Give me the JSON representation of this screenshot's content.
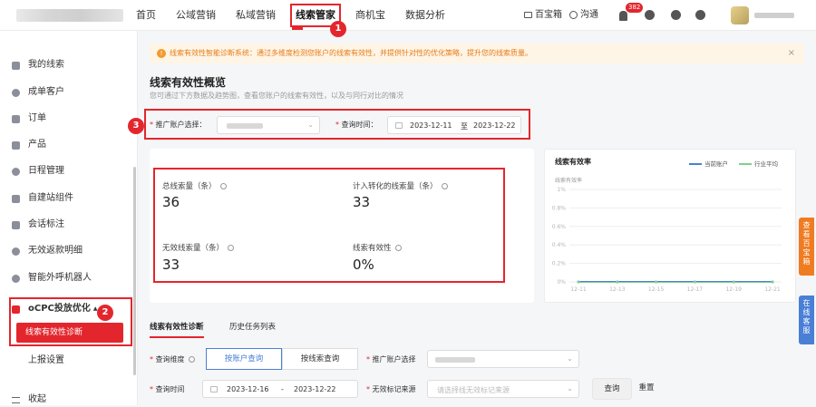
{
  "topbar": {
    "nav": [
      "首页",
      "公域营销",
      "私域营销",
      "线索管家",
      "商机宝",
      "数据分析"
    ],
    "active_nav": "线索管家",
    "baibaoxiang": "百宝箱",
    "goutong": "沟通",
    "notification_count": "382"
  },
  "sidebar": {
    "items": [
      "我的线索",
      "成单客户",
      "订单",
      "产品",
      "日程管理",
      "自建站组件",
      "会话标注",
      "无效返款明细",
      "智能外呼机器人",
      "oCPC投放优化",
      "线索有效性诊断",
      "上报设置",
      "收起"
    ],
    "active_item": "线索有效性诊断"
  },
  "annotations": [
    "1",
    "2",
    "3"
  ],
  "alert": {
    "text": "线索有效性智能诊断系统：通过多维度检测您账户的线索有效性，并提供针对性的优化策略，提升您的线索质量。",
    "close": "×"
  },
  "overview": {
    "title": "线索有效性概览",
    "subtitle": "您可通过下方数据及趋势图，查看您账户的线索有效性，以及与同行对比的情况",
    "account_label": "推广账户选择：",
    "time_label": "查询时间：",
    "date_start": "2023-12-11",
    "date_sep": "至",
    "date_end": "2023-12-22"
  },
  "stats": {
    "total_label": "总线索量（条）",
    "total_value": "36",
    "converted_label": "计入转化的线索量（条）",
    "converted_value": "33",
    "invalid_label": "无效线索量（条）",
    "invalid_value": "33",
    "valid_rate_label": "线索有效性",
    "valid_rate_value": "0%"
  },
  "chart_data": {
    "type": "line",
    "title": "线索有效率",
    "ylabel": "线索有效率",
    "y_ticks": [
      "1%",
      "0.8%",
      "0.6%",
      "0.4%",
      "0.2%",
      "0%"
    ],
    "ylim": [
      0,
      1
    ],
    "x": [
      "12-11",
      "12-13",
      "12-15",
      "12-17",
      "12-19",
      "12-21"
    ],
    "series": [
      {
        "name": "当前账户",
        "color": "#4a7fd6",
        "values": [
          0,
          0,
          0,
          0,
          0,
          0
        ]
      },
      {
        "name": "行业平均",
        "color": "#7fcf8f",
        "values": [
          0,
          0,
          0,
          0,
          0,
          0
        ]
      }
    ],
    "legend": "top-right",
    "grid": true
  },
  "side_tabs": [
    "查看百宝箱",
    "在线客服"
  ],
  "diag": {
    "tab_diagnose": "线索有效性诊断",
    "tab_history": "历史任务列表",
    "dimension_label": "查询维度",
    "by_account": "按账户查询",
    "by_lead": "按线索查询",
    "account_label": "推广账户选择",
    "time_label": "查询时间",
    "date_start": "2023-12-16",
    "date_sep": "-",
    "date_end": "2023-12-22",
    "source_label": "无效标记来源",
    "source_placeholder": "请选择线无效标记来源",
    "query_button": "查询",
    "reset_button": "重置"
  }
}
